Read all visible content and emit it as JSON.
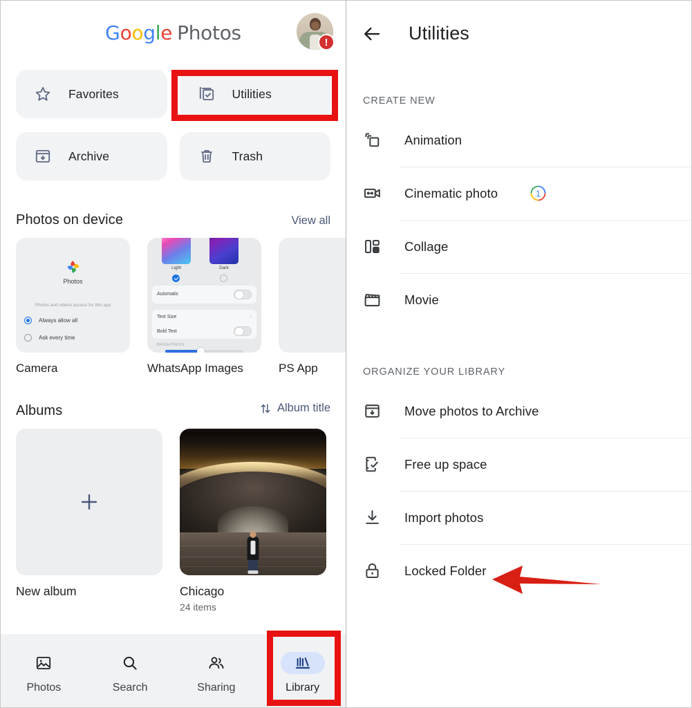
{
  "left_panel": {
    "logo": {
      "part1": "Google",
      "part2": "Photos",
      "letters": [
        "G",
        "o",
        "o",
        "g",
        "l",
        "e"
      ]
    },
    "avatar": {
      "name": "account-avatar",
      "alert_badge": "!"
    },
    "quick_access": [
      {
        "label": "Favorites",
        "icon": "star-icon"
      },
      {
        "label": "Utilities",
        "icon": "utilities-checkbox-icon",
        "highlighted": true
      },
      {
        "label": "Archive",
        "icon": "archive-box-icon"
      },
      {
        "label": "Trash",
        "icon": "trash-icon"
      }
    ],
    "photos_on_device": {
      "title": "Photos on device",
      "action": "View all",
      "items": [
        {
          "name": "Camera"
        },
        {
          "name": "WhatsApp Images"
        },
        {
          "name": "PS App"
        }
      ],
      "camera_thumb": {
        "app_name": "Photos",
        "permission_text": "Photos and videos access for this app",
        "option_allow": "Always allow all",
        "option_ask": "Ask every time"
      },
      "whatsapp_thumb": {
        "light_label": "Light",
        "dark_label": "Dark",
        "automatic": "Automatic",
        "text_size": "Text Size",
        "bold_text": "Bold Text",
        "brightness": "BRIGHTNESS"
      }
    },
    "albums": {
      "title": "Albums",
      "sort_label": "Album title",
      "sort_icon": "sort-arrows-icon",
      "items": [
        {
          "name": "New album",
          "sub": "",
          "icon": "plus-icon"
        },
        {
          "name": "Chicago",
          "sub": "24 items"
        }
      ]
    },
    "bottom_nav": [
      {
        "label": "Photos",
        "icon": "photo-icon",
        "active": false
      },
      {
        "label": "Search",
        "icon": "search-icon",
        "active": false
      },
      {
        "label": "Sharing",
        "icon": "people-icon",
        "active": false
      },
      {
        "label": "Library",
        "icon": "library-icon",
        "active": true
      }
    ]
  },
  "right_panel": {
    "back_icon": "arrow-left-icon",
    "title": "Utilities",
    "groups": [
      {
        "label": "CREATE NEW",
        "items": [
          {
            "label": "Animation",
            "icon": "animation-stack-icon"
          },
          {
            "label": "Cinematic photo",
            "icon": "cinematic-video-icon",
            "badge": "1"
          },
          {
            "label": "Collage",
            "icon": "collage-icon"
          },
          {
            "label": "Movie",
            "icon": "movie-clapper-icon"
          }
        ]
      },
      {
        "label": "ORGANIZE YOUR LIBRARY",
        "items": [
          {
            "label": "Move photos to Archive",
            "icon": "archive-box-icon"
          },
          {
            "label": "Free up space",
            "icon": "free-space-phone-icon"
          },
          {
            "label": "Import photos",
            "icon": "download-icon"
          },
          {
            "label": "Locked Folder",
            "icon": "lock-icon"
          }
        ]
      }
    ]
  },
  "annotations": {
    "highlight_color": "#e81212",
    "arrow_color": "#d81f14",
    "highlighted_items": [
      "Utilities",
      "Library",
      "Locked Folder"
    ]
  },
  "colors": {
    "google_blue": "#4285F4",
    "google_red": "#EA4335",
    "google_yellow": "#FBBC05",
    "google_green": "#34A853",
    "tile_bg": "#f1f3f4",
    "accent_pill": "#d7e3fb",
    "text_primary": "#202124",
    "text_secondary": "#5f6368"
  }
}
